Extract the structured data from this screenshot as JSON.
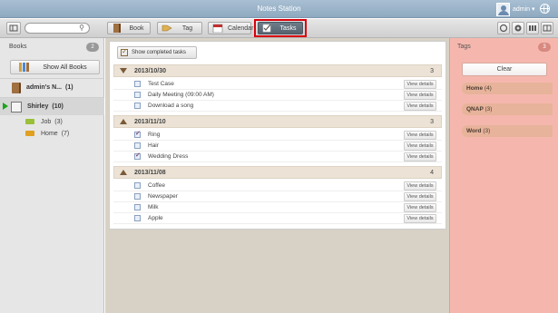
{
  "window": {
    "title": "Notes Station",
    "user": "admin ▾"
  },
  "toolbar": {
    "search_placeholder": "",
    "tabs": [
      {
        "label": "Book"
      },
      {
        "label": "Tag"
      },
      {
        "label": "Calendar"
      },
      {
        "label": "Tasks",
        "active": true
      }
    ]
  },
  "sidebar": {
    "title": "Books",
    "count": "2",
    "show_all": "Show All Books",
    "books": [
      {
        "label": "admin's N...",
        "count": "(1)"
      },
      {
        "label": "Shirley",
        "count": "(10)"
      }
    ],
    "subitems": [
      {
        "label": "Job",
        "count": "(3)",
        "color": "#9abf3a"
      },
      {
        "label": "Home",
        "count": "(7)",
        "color": "#e0a020"
      }
    ]
  },
  "tasks": {
    "show_completed": "Show completed tasks",
    "view_details": "View details",
    "groups": [
      {
        "date": "2013/10/30",
        "count": "3",
        "items": [
          {
            "label": "Test Case",
            "checked": false
          },
          {
            "label": "Daily Meeting (09:00 AM)",
            "checked": false
          },
          {
            "label": "Download a song",
            "checked": false
          }
        ]
      },
      {
        "date": "2013/11/10",
        "count": "3",
        "items": [
          {
            "label": "Ring",
            "checked": true
          },
          {
            "label": "Hair",
            "checked": false
          },
          {
            "label": "Wedding Dress",
            "checked": true
          }
        ]
      },
      {
        "date": "2013/11/08",
        "count": "4",
        "items": [
          {
            "label": "Coffee",
            "checked": false
          },
          {
            "label": "Newspaper",
            "checked": false
          },
          {
            "label": "Milk",
            "checked": false
          },
          {
            "label": "Apple",
            "checked": false
          }
        ]
      }
    ]
  },
  "tags": {
    "title": "Tags",
    "count": "3",
    "clear": "Clear",
    "items": [
      {
        "label": "Home",
        "count": "(4)"
      },
      {
        "label": "QNAP",
        "count": "(3)"
      },
      {
        "label": "Word",
        "count": "(3)"
      }
    ]
  },
  "colors": {
    "highlight": "#d8000c",
    "tag_panel": "#f5b7ad",
    "group_header": "#ece3d6"
  }
}
